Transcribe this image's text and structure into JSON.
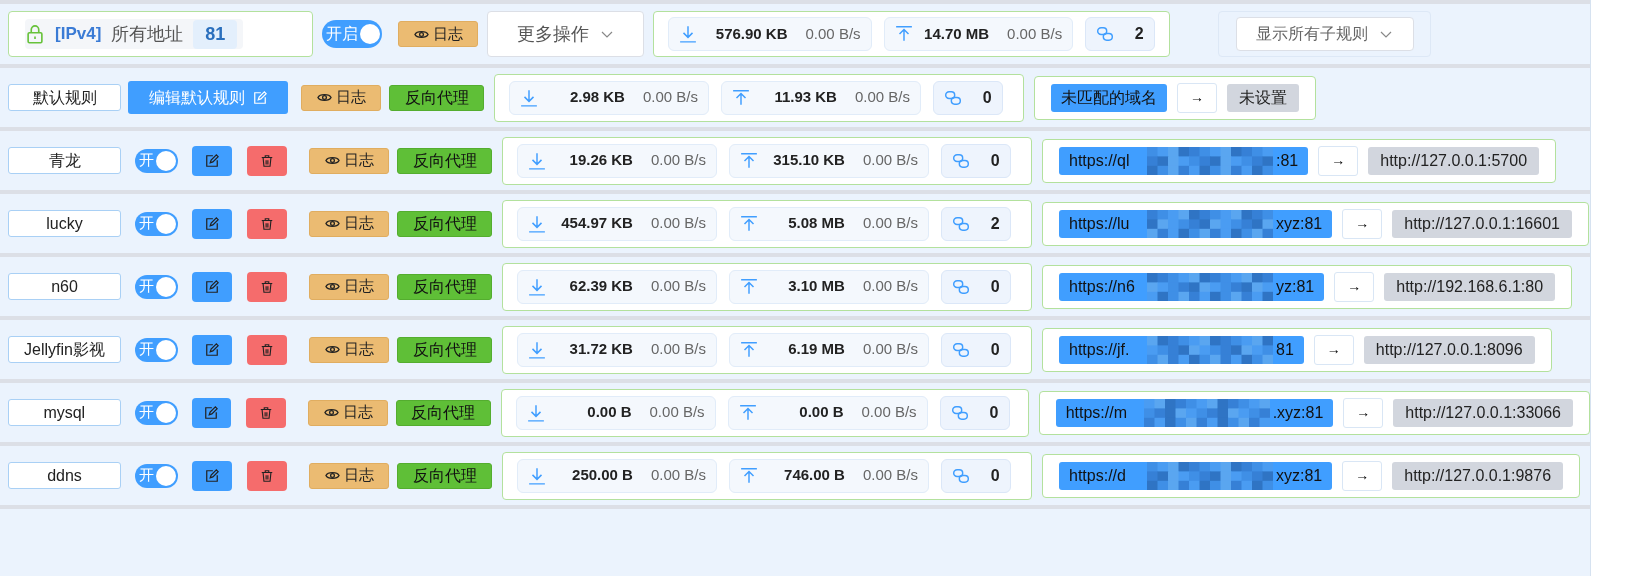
{
  "header": {
    "protocol": "[IPv4]",
    "address": "所有地址",
    "port": "81",
    "enabled": true,
    "toggle_label": "开启",
    "log": "日志",
    "more": "更多操作",
    "traffic": {
      "down": "576.90 KB",
      "down_rate": "0.00 B/s",
      "up": "14.70 MB",
      "up_rate": "0.00 B/s",
      "connections": "2"
    },
    "filter": "显示所有子规则"
  },
  "default_rule": {
    "name": "默认规则",
    "edit": "编辑默认规则",
    "log": "日志",
    "type": "反向代理",
    "traffic": {
      "down": "2.98 KB",
      "down_rate": "0.00 B/s",
      "up": "11.93 KB",
      "up_rate": "0.00 B/s",
      "connections": "0"
    },
    "domain": "未匹配的域名",
    "arrow": "→",
    "target": "未设置"
  },
  "rules": [
    {
      "name": "青龙",
      "enabled": true,
      "toggle_label": "开",
      "log": "日志",
      "type": "反向代理",
      "traffic": {
        "down": "19.26 KB",
        "down_rate": "0.00 B/s",
        "up": "315.10 KB",
        "up_rate": "0.00 B/s",
        "connections": "0"
      },
      "domain_start": "https://ql",
      "domain_end": ":81",
      "arrow": "→",
      "target": "http://127.0.0.1:5700"
    },
    {
      "name": "lucky",
      "enabled": true,
      "toggle_label": "开",
      "log": "日志",
      "type": "反向代理",
      "traffic": {
        "down": "454.97 KB",
        "down_rate": "0.00 B/s",
        "up": "5.08 MB",
        "up_rate": "0.00 B/s",
        "connections": "2"
      },
      "domain_start": "https://lu",
      "domain_end": "xyz:81",
      "arrow": "→",
      "target": "http://127.0.0.1:16601"
    },
    {
      "name": "n60",
      "enabled": true,
      "toggle_label": "开",
      "log": "日志",
      "type": "反向代理",
      "traffic": {
        "down": "62.39 KB",
        "down_rate": "0.00 B/s",
        "up": "3.10 MB",
        "up_rate": "0.00 B/s",
        "connections": "0"
      },
      "domain_start": "https://n6",
      "domain_end": "yz:81",
      "arrow": "→",
      "target": "http://192.168.6.1:80"
    },
    {
      "name": "Jellyfin影视",
      "enabled": true,
      "toggle_label": "开",
      "log": "日志",
      "type": "反向代理",
      "traffic": {
        "down": "31.72 KB",
        "down_rate": "0.00 B/s",
        "up": "6.19 MB",
        "up_rate": "0.00 B/s",
        "connections": "0"
      },
      "domain_start": "https://jf.",
      "domain_end": "81",
      "arrow": "→",
      "target": "http://127.0.0.1:8096"
    },
    {
      "name": "mysql",
      "enabled": true,
      "toggle_label": "开",
      "log": "日志",
      "type": "反向代理",
      "traffic": {
        "down": "0.00 B",
        "down_rate": "0.00 B/s",
        "up": "0.00 B",
        "up_rate": "0.00 B/s",
        "connections": "0"
      },
      "domain_start": "https://m",
      "domain_end": ".xyz:81",
      "arrow": "→",
      "target": "http://127.0.0.1:33066"
    },
    {
      "name": "ddns",
      "enabled": true,
      "toggle_label": "开",
      "log": "日志",
      "type": "反向代理",
      "traffic": {
        "down": "250.00 B",
        "down_rate": "0.00 B/s",
        "up": "746.00 B",
        "up_rate": "0.00 B/s",
        "connections": "0"
      },
      "domain_start": "https://d",
      "domain_end": "xyz:81",
      "arrow": "→",
      "target": "http://127.0.0.1:9876"
    }
  ]
}
